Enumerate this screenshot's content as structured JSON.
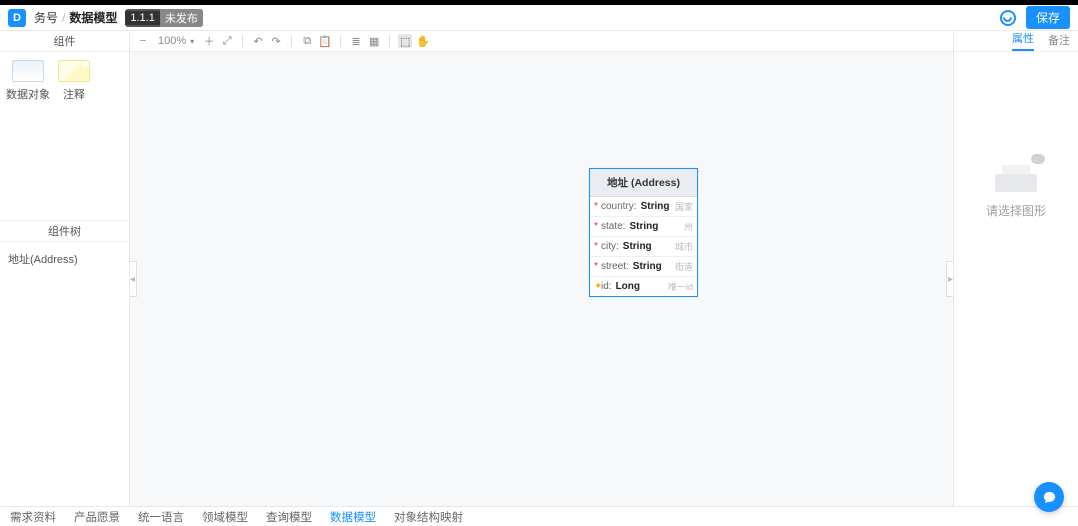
{
  "header": {
    "logo_letter": "D",
    "breadcrumb_root": "务号",
    "breadcrumb_current": "数据模型",
    "version": "1.1.1",
    "version_status": "未发布",
    "save_label": "保存"
  },
  "left": {
    "components_title": "组件",
    "tool_data_object": "数据对象",
    "tool_note": "注释",
    "tree_title": "组件树",
    "tree_item_0": "地址(Address)"
  },
  "toolbar": {
    "zoom": "100%"
  },
  "entity": {
    "title": "地址 (Address)",
    "fields": [
      {
        "name": "country",
        "type": "String",
        "desc": "国家"
      },
      {
        "name": "state",
        "type": "String",
        "desc": "州"
      },
      {
        "name": "city",
        "type": "String",
        "desc": "城市"
      },
      {
        "name": "street",
        "type": "String",
        "desc": "街道"
      },
      {
        "name": "id",
        "type": "Long",
        "desc": "唯一id",
        "key": true
      }
    ]
  },
  "right": {
    "tab_props": "属性",
    "tab_comments": "备注",
    "empty_text": "请选择图形"
  },
  "footer": {
    "t0": "需求资料",
    "t1": "产品愿景",
    "t2": "统一语言",
    "t3": "领域模型",
    "t4": "查询模型",
    "t5": "数据模型",
    "t6": "对象结构映射"
  }
}
